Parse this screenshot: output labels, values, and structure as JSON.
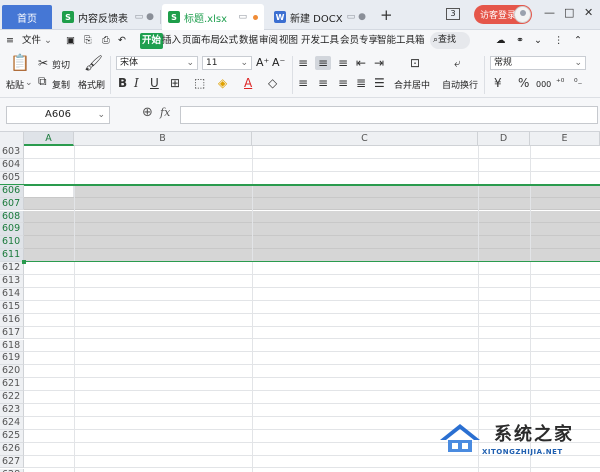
{
  "tabs": {
    "home": "首页",
    "items": [
      {
        "label": "内容反馈表",
        "type": "xls",
        "badge": "S"
      },
      {
        "label": "标题.xlsx",
        "type": "xls",
        "badge": "S",
        "active": true
      },
      {
        "label": "新建 DOCX 文",
        "type": "doc",
        "badge": "W"
      }
    ],
    "window_count": "3",
    "guest_login": "访客登录"
  },
  "menu": {
    "file": "文件",
    "items": [
      "开始",
      "插入",
      "页面布局",
      "公式",
      "数据",
      "审阅",
      "视图",
      "开发工具",
      "会员专享",
      "智能工具箱"
    ],
    "active": "开始",
    "search": "查找"
  },
  "ribbon": {
    "paste": "粘贴",
    "cut": "剪切",
    "copy": "复制",
    "format_painter": "格式刷",
    "font_name": "宋体",
    "font_size": "11",
    "merge_center": "合并居中",
    "wrap_text": "自动换行",
    "number_format": "常规",
    "currency": "¥",
    "percent": "%",
    "thousands": "000"
  },
  "formula_bar": {
    "name_box": "A606",
    "fx": "fx",
    "formula": ""
  },
  "grid": {
    "columns": [
      "A",
      "B",
      "C",
      "D",
      "E"
    ],
    "rows": [
      "603",
      "604",
      "605",
      "606",
      "607",
      "608",
      "609",
      "610",
      "611",
      "612",
      "613",
      "614",
      "615",
      "616",
      "617",
      "618",
      "619",
      "620",
      "621",
      "622",
      "623",
      "624",
      "625",
      "626",
      "627",
      "628"
    ],
    "selected_rows": [
      "606",
      "607",
      "608",
      "609",
      "610",
      "611"
    ],
    "active_cell": "A606"
  },
  "watermark": {
    "text": "系统之家",
    "url": "XITONGZHIJIA.NET"
  },
  "colors": {
    "accent": "#1f9f4f",
    "home_tab": "#4577d5",
    "guest": "#e5564a",
    "selection": "#d6d6d6"
  }
}
